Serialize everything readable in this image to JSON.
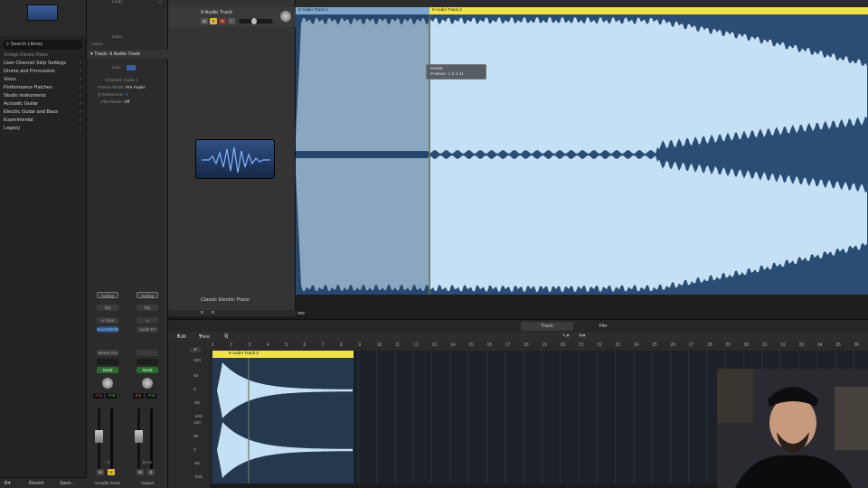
{
  "library": {
    "search_placeholder": "Search Library",
    "preset": "Vintage Electric Piano",
    "items": [
      "User Channel Strip Settings",
      "Drums and Percussion",
      "Voice",
      "Performance Patches",
      "Studio Instruments",
      "Acoustic Guitar",
      "Electric Guitar and Bass",
      "Experimental",
      "Legacy"
    ],
    "revert": "Revert",
    "save": "Save..."
  },
  "inspector": {
    "loop": "Loop:",
    "gain": "Gain:",
    "more": "More",
    "track_header": "Track:  9 Audio Track",
    "icon_label": "Icon:",
    "channel_label": "Channel:",
    "channel_value": "Audio 1",
    "freeze_label": "Freeze Mode:",
    "freeze_value": "Pre Fader",
    "qref_label": "Q-Reference:",
    "flex_label": "Flex Mode:",
    "flex_value": "Off",
    "strips": [
      {
        "setting": "Setting",
        "eq": "EQ",
        "input": "Input",
        "insert": "SoundShifte",
        "output": "Stereo Out",
        "auto": "Read",
        "vol_l": "-7.2",
        "vol_r": "-7.3",
        "name": "9 Audio Track",
        "m": "M",
        "s": "S",
        "io_l": "I",
        "io_r": "R"
      },
      {
        "setting": "Setting",
        "eq": "EQ",
        "input": "",
        "insert": "Audio FX",
        "output": "",
        "auto": "Read",
        "vol_l": "0.0",
        "vol_r": "-7.2",
        "name": "Output",
        "m": "M",
        "s": "S",
        "io_l": "",
        "io_r": "Bnce"
      }
    ]
  },
  "track": {
    "name": "9 Audio Track",
    "m": "M",
    "s": "S",
    "r": "R",
    "i": "I",
    "instrument": "Classic Electric Piano",
    "foot_b": "B",
    "foot_r": "R"
  },
  "regions": {
    "top_left": "9 Audio Track.1",
    "top_right": "9 Audio Track.2",
    "bottom": "9 Audio Track.2",
    "tooltip_line1": "Divide:",
    "tooltip_line2": "Position:  1 2 3 41"
  },
  "tabs": {
    "track": "Track",
    "file": "File"
  },
  "subbar": {
    "edit": "Edit",
    "view": "View"
  },
  "ruler": [
    "1",
    "2",
    "3",
    "4",
    "5",
    "6",
    "7",
    "8",
    "9",
    "10",
    "11",
    "12",
    "13",
    "14",
    "15",
    "16",
    "17",
    "18",
    "19",
    "20",
    "21",
    "22",
    "23",
    "24",
    "25",
    "26",
    "27",
    "28",
    "29",
    "30",
    "31",
    "32",
    "33",
    "34",
    "35",
    "36"
  ],
  "scale": [
    "100",
    "50",
    "0",
    "-50",
    "-100",
    "100",
    "50",
    "0",
    "-50",
    "-100"
  ],
  "colors": {
    "region_blue": "#c5dff5",
    "region_dark": "#2b4d73",
    "region_yellow": "#f0e34a"
  }
}
